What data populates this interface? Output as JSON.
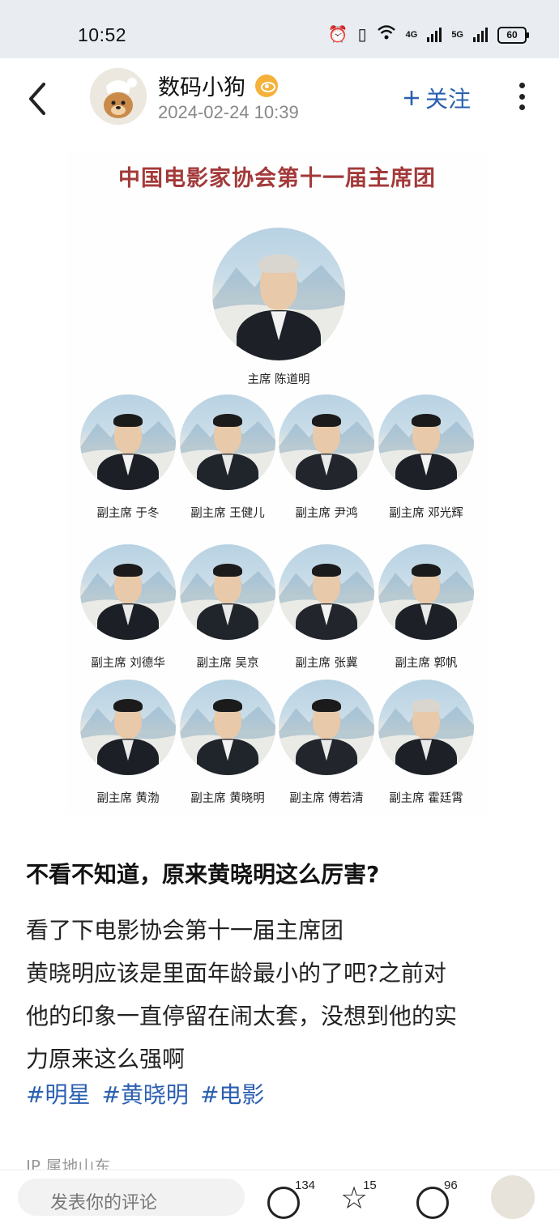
{
  "status_bar": {
    "time": "10:52",
    "network1": "4G",
    "network2": "5G",
    "battery": "60",
    "icons": [
      "alarm-icon",
      "vibrate-icon",
      "wifi-icon",
      "signal-icon",
      "signal-icon",
      "battery-icon"
    ]
  },
  "header": {
    "username": "数码小狗",
    "date": "2024-02-24 10:39",
    "follow_label": "关注",
    "follow_icon": "plus-icon",
    "accent_color": "#2a5fb0"
  },
  "poster": {
    "title": "中国电影家协会第十一届主席团",
    "chairman_caption": "主席  陈道明",
    "rows": [
      [
        "副主席  于冬",
        "副主席  王健儿",
        "副主席  尹鸿",
        "副主席  邓光辉"
      ],
      [
        "副主席  刘德华",
        "副主席  吴京",
        "副主席  张冀",
        "副主席  郭帆"
      ],
      [
        "副主席  黄渤",
        "副主席  黄晓明",
        "副主席  傅若清",
        "副主席  霍廷霄"
      ]
    ]
  },
  "post": {
    "title": "不看不知道，原来黄晓明这么厉害?",
    "body_lines": [
      "看了下电影协会第十一届主席团",
      "黄晓明应该是里面年龄最小的了吧?之前对",
      "他的印象一直停留在闹太套，没想到他的实",
      "力原来这么强啊"
    ],
    "tags": [
      "#明星",
      "#黄晓明",
      "#电影"
    ],
    "ip_label": "IP 属地山东"
  },
  "bottom_bar": {
    "comment_placeholder": "发表你的评论",
    "like_count": "134",
    "star_count": "15",
    "share_count": "96"
  }
}
